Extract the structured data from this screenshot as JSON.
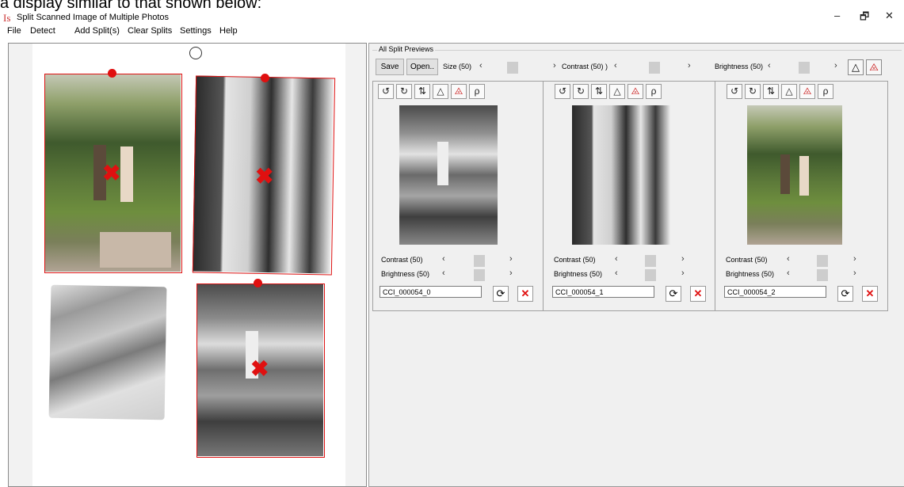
{
  "doc_caption": "a display similar to that shown below:",
  "window": {
    "icon": "Is",
    "title": "Split Scanned Image of Multiple Photos",
    "controls": [
      "–",
      "🗗",
      "✕"
    ]
  },
  "menu": [
    "File",
    "Detect",
    "Add Split(s)",
    "Clear Splits",
    "Settings",
    "Help"
  ],
  "toolbar": {
    "group_label": "All Split Previews",
    "save_label": "Save",
    "open_label": "Open..",
    "size_label": "Size (50)",
    "contrast_label": "Contrast (50) )",
    "brightness_label": "Brightness (50)",
    "size_value": 50,
    "contrast_value": 50,
    "brightness_value": 50
  },
  "panels": [
    {
      "name": "CCI_000054_0",
      "contrast_label": "Contrast (50)",
      "brightness_label": "Brightness (50)",
      "contrast": 50,
      "brightness": 50
    },
    {
      "name": "CCI_000054_1",
      "contrast_label": "Contrast (50)",
      "brightness_label": "Brightness (50)",
      "contrast": 50,
      "brightness": 50
    },
    {
      "name": "CCI_000054_2",
      "contrast_label": "Contrast (50)",
      "brightness_label": "Brightness (50)",
      "contrast": 50,
      "brightness": 50
    }
  ],
  "glyphs": {
    "rotate_left": "↺",
    "rotate_right": "↻",
    "flip": "⇅",
    "contrast": "△",
    "no_contrast": "⨻",
    "pick": "ρ",
    "arrow_left": "‹",
    "arrow_right": "›",
    "reset": "⟳",
    "delete": "✕",
    "split_marker": "✖"
  },
  "colors": {
    "marker": "#e01010",
    "panel_bg": "#f0f0f0"
  }
}
